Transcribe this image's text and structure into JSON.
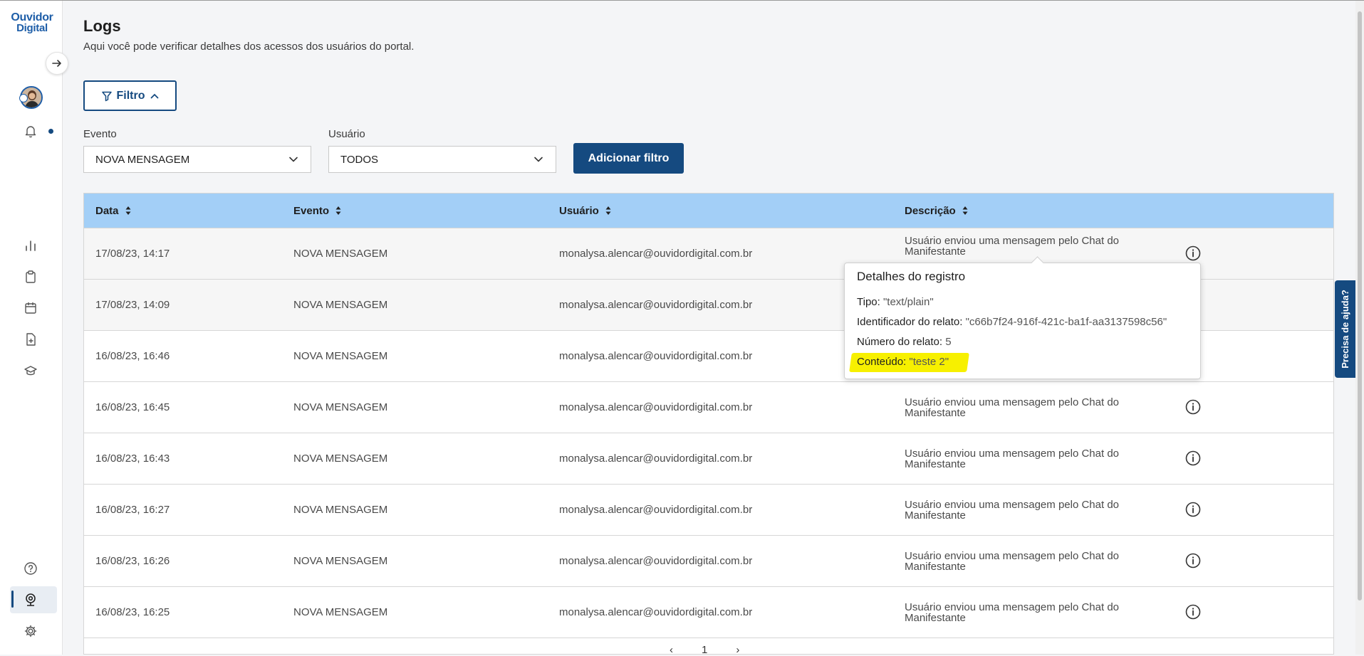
{
  "brand": {
    "logo_line1": "Ouvidor",
    "logo_line2": "Digital"
  },
  "sidebar": {
    "icons": [
      "arrow-right-icon",
      "avatar",
      "bell-icon",
      "bar-chart-icon",
      "clipboard-icon",
      "calendar-icon",
      "file-plus-icon",
      "graduation-cap-icon",
      "help-circle-icon",
      "webcam-icon",
      "gear-icon"
    ]
  },
  "header": {
    "title": "Logs",
    "subtitle": "Aqui você pode verificar detalhes dos acessos dos usuários do portal."
  },
  "filters": {
    "toggle_label": "Filtro",
    "event_label": "Evento",
    "event_value": "NOVA MENSAGEM",
    "user_label": "Usuário",
    "user_value": "TODOS",
    "add_filter_label": "Adicionar filtro"
  },
  "table": {
    "columns": [
      "Data",
      "Evento",
      "Usuário",
      "Descrição"
    ],
    "rows": [
      {
        "date": "17/08/23, 14:17",
        "event": "NOVA MENSAGEM",
        "user": "monalysa.alencar@ouvidordigital.com.br",
        "description": "Usuário enviou uma mensagem pelo Chat do Manifestante"
      },
      {
        "date": "17/08/23, 14:09",
        "event": "NOVA MENSAGEM",
        "user": "monalysa.alencar@ouvidordigital.com.br",
        "description": ""
      },
      {
        "date": "16/08/23, 16:46",
        "event": "NOVA MENSAGEM",
        "user": "monalysa.alencar@ouvidordigital.com.br",
        "description": ""
      },
      {
        "date": "16/08/23, 16:45",
        "event": "NOVA MENSAGEM",
        "user": "monalysa.alencar@ouvidordigital.com.br",
        "description": "Usuário enviou uma mensagem pelo Chat do Manifestante"
      },
      {
        "date": "16/08/23, 16:43",
        "event": "NOVA MENSAGEM",
        "user": "monalysa.alencar@ouvidordigital.com.br",
        "description": "Usuário enviou uma mensagem pelo Chat do Manifestante"
      },
      {
        "date": "16/08/23, 16:27",
        "event": "NOVA MENSAGEM",
        "user": "monalysa.alencar@ouvidordigital.com.br",
        "description": "Usuário enviou uma mensagem pelo Chat do Manifestante"
      },
      {
        "date": "16/08/23, 16:26",
        "event": "NOVA MENSAGEM",
        "user": "monalysa.alencar@ouvidordigital.com.br",
        "description": "Usuário enviou uma mensagem pelo Chat do Manifestante"
      },
      {
        "date": "16/08/23, 16:25",
        "event": "NOVA MENSAGEM",
        "user": "monalysa.alencar@ouvidordigital.com.br",
        "description": "Usuário enviou uma mensagem pelo Chat do Manifestante"
      }
    ]
  },
  "pagination": {
    "prev": "‹",
    "page": "1",
    "next": "›"
  },
  "popover": {
    "title": "Detalhes do registro",
    "tipo_label": "Tipo:",
    "tipo_value": "\"text/plain\"",
    "id_label": "Identificador do relato:",
    "id_value": "\"c66b7f24-916f-421c-ba1f-aa3137598c56\"",
    "numero_label": "Número do relato:",
    "numero_value": "5",
    "conteudo_label": "Conteúdo:",
    "conteudo_value": "\"teste 2\""
  },
  "help_tab": {
    "label": "Precisa de ajuda?"
  },
  "colors": {
    "primary": "#154a80",
    "table_header": "#a3cff7",
    "highlight": "#f7f000"
  }
}
